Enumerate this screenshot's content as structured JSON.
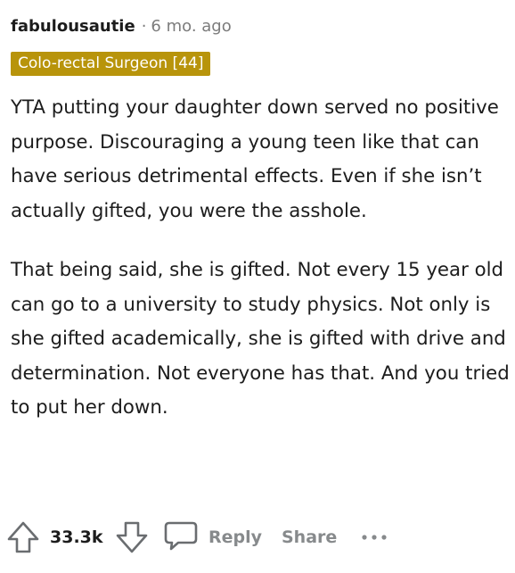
{
  "comment": {
    "username": "fabulousautie",
    "separator": "·",
    "timestamp": "6 mo. ago",
    "flair": "Colo-rectal Surgeon [44]",
    "flair_color": "#b8940b",
    "paragraphs": [
      "YTA putting your daughter down served no positive purpose. Discouraging a young teen like that can have serious detrimental effects. Even if she isn’t actually gifted, you were the asshole.",
      "That being said, she is gifted. Not every 15 year old can go to a university to study physics. Not only is she gifted academically, she is gifted with drive and determination. Not everyone has that. And you tried to put her down."
    ]
  },
  "actions": {
    "upvote_icon": "upvote-arrow-icon",
    "score": "33.3k",
    "downvote_icon": "downvote-arrow-icon",
    "reply_icon": "comment-bubble-icon",
    "reply_label": "Reply",
    "share_label": "Share",
    "more_icon": "more-dots-icon"
  }
}
